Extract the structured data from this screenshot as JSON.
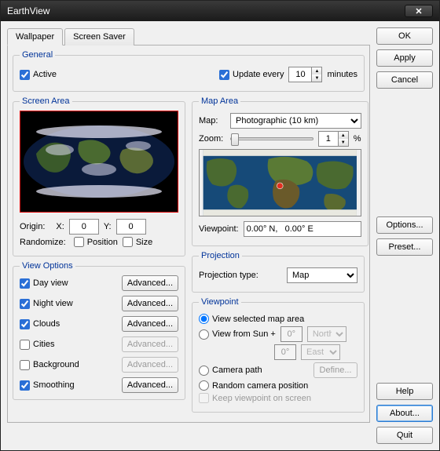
{
  "window": {
    "title": "EarthView"
  },
  "tabs": {
    "wallpaper": "Wallpaper",
    "screensaver": "Screen Saver"
  },
  "buttons": {
    "ok": "OK",
    "apply": "Apply",
    "cancel": "Cancel",
    "options": "Options...",
    "preset": "Preset...",
    "help": "Help",
    "about": "About...",
    "quit": "Quit",
    "advanced": "Advanced...",
    "define": "Define..."
  },
  "general": {
    "legend": "General",
    "active": "Active",
    "update_every": "Update every",
    "update_value": "10",
    "minutes": "minutes"
  },
  "screen_area": {
    "legend": "Screen Area",
    "origin": "Origin:",
    "x": "X:",
    "x_val": "0",
    "y": "Y:",
    "y_val": "0",
    "randomize": "Randomize:",
    "position": "Position",
    "size": "Size"
  },
  "map_area": {
    "legend": "Map Area",
    "map": "Map:",
    "map_val": "Photographic (10 km)",
    "zoom": "Zoom:",
    "zoom_val": "1",
    "pct": "%",
    "viewpoint": "Viewpoint:",
    "viewpoint_val": "0.00° N,   0.00° E"
  },
  "projection": {
    "legend": "Projection",
    "type_label": "Projection type:",
    "type_val": "Map"
  },
  "view_options": {
    "legend": "View Options",
    "day": "Day view",
    "night": "Night view",
    "clouds": "Clouds",
    "cities": "Cities",
    "background": "Background",
    "smoothing": "Smoothing"
  },
  "viewpoint": {
    "legend": "Viewpoint",
    "selected": "View selected map area",
    "from_sun": "View from Sun +",
    "deg1": "0°",
    "dir1": "North",
    "deg2": "0°",
    "dir2": "East",
    "camera": "Camera path",
    "random": "Random camera position",
    "keep": "Keep viewpoint on screen"
  }
}
